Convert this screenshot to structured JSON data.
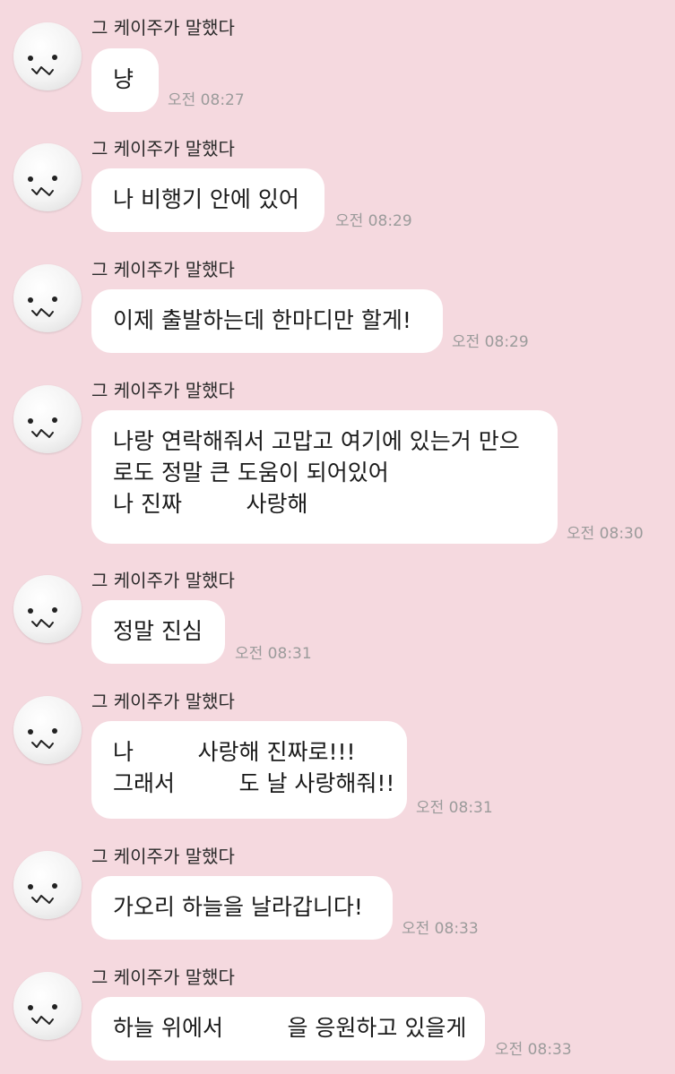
{
  "sender_name": "그 케이주가 말했다",
  "messages": [
    {
      "lines": [
        "냥"
      ],
      "time": "오전 08:27"
    },
    {
      "lines": [
        "나 비행기 안에 있어"
      ],
      "time": "오전 08:29"
    },
    {
      "lines": [
        "이제 출발하는데 한마디만 할게!"
      ],
      "time": "오전 08:29"
    },
    {
      "lines": [
        "나랑 연락해줘서 고맙고 여기에 있는거 만으",
        "로도 정말 큰 도움이 되어있어",
        "나 진짜         사랑해"
      ],
      "time": "오전 08:30"
    },
    {
      "lines": [
        "정말 진심"
      ],
      "time": "오전 08:31"
    },
    {
      "lines": [
        "나         사랑해 진짜로!!!",
        "그래서         도 날 사랑해줘!!"
      ],
      "time": "오전 08:31"
    },
    {
      "lines": [
        "가오리 하늘을 날라갑니다!"
      ],
      "time": "오전 08:33"
    },
    {
      "lines": [
        "하늘 위에서         을 응원하고 있을게"
      ],
      "time": "오전 08:33"
    }
  ]
}
